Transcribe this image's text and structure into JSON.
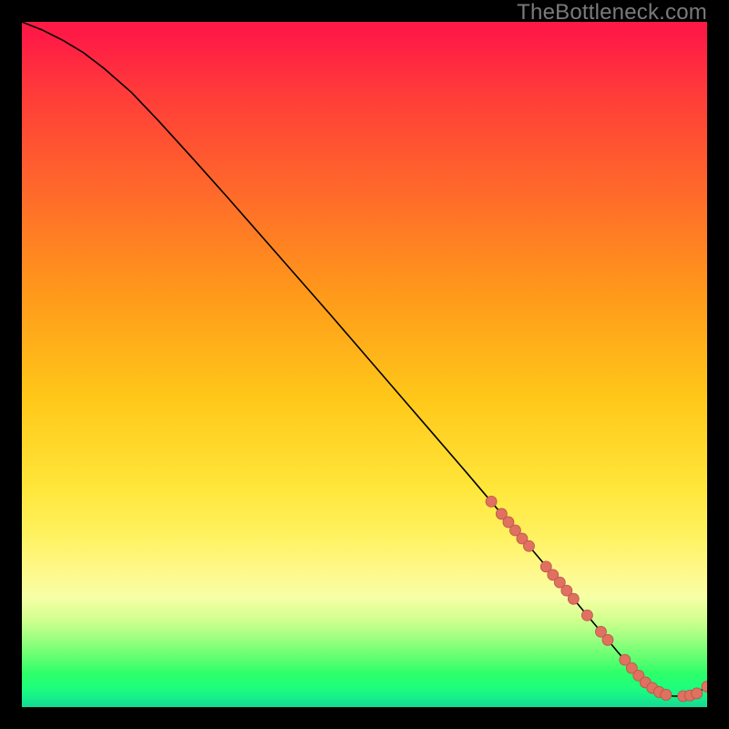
{
  "watermark": "TheBottleneck.com",
  "colors": {
    "curve_stroke": "#000000",
    "marker_fill": "#e07060",
    "marker_stroke": "#b85448"
  },
  "chart_data": {
    "type": "line",
    "title": "",
    "xlabel": "",
    "ylabel": "",
    "xlim": [
      0,
      100
    ],
    "ylim": [
      0,
      100
    ],
    "series": [
      {
        "name": "curve",
        "x": [
          0,
          3,
          6,
          9,
          12,
          16,
          20,
          25,
          30,
          35,
          40,
          45,
          50,
          55,
          60,
          65,
          70,
          74,
          78,
          81,
          83,
          85,
          87,
          89,
          91,
          93,
          95,
          97,
          99,
          100
        ],
        "y": [
          100,
          98.8,
          97.3,
          95.5,
          93.2,
          89.7,
          85.5,
          80.0,
          74.4,
          68.7,
          63.0,
          57.3,
          51.5,
          45.7,
          39.9,
          34.1,
          28.2,
          23.5,
          18.8,
          15.2,
          12.8,
          10.4,
          8.0,
          5.7,
          3.6,
          2.2,
          1.6,
          1.6,
          2.4,
          3.0
        ]
      }
    ],
    "markers": [
      {
        "x": 68.5,
        "y": 30.0
      },
      {
        "x": 70.0,
        "y": 28.2
      },
      {
        "x": 71.0,
        "y": 27.0
      },
      {
        "x": 72.0,
        "y": 25.8
      },
      {
        "x": 73.0,
        "y": 24.6
      },
      {
        "x": 74.0,
        "y": 23.5
      },
      {
        "x": 76.5,
        "y": 20.5
      },
      {
        "x": 77.5,
        "y": 19.3
      },
      {
        "x": 78.5,
        "y": 18.2
      },
      {
        "x": 79.5,
        "y": 17.0
      },
      {
        "x": 80.5,
        "y": 15.8
      },
      {
        "x": 82.5,
        "y": 13.4
      },
      {
        "x": 84.5,
        "y": 11.0
      },
      {
        "x": 85.5,
        "y": 9.8
      },
      {
        "x": 88.0,
        "y": 6.9
      },
      {
        "x": 89.0,
        "y": 5.7
      },
      {
        "x": 90.0,
        "y": 4.6
      },
      {
        "x": 91.0,
        "y": 3.6
      },
      {
        "x": 92.0,
        "y": 2.8
      },
      {
        "x": 93.0,
        "y": 2.2
      },
      {
        "x": 94.0,
        "y": 1.8
      },
      {
        "x": 96.5,
        "y": 1.6
      },
      {
        "x": 97.5,
        "y": 1.7
      },
      {
        "x": 98.5,
        "y": 2.0
      },
      {
        "x": 100.0,
        "y": 3.0
      }
    ]
  }
}
